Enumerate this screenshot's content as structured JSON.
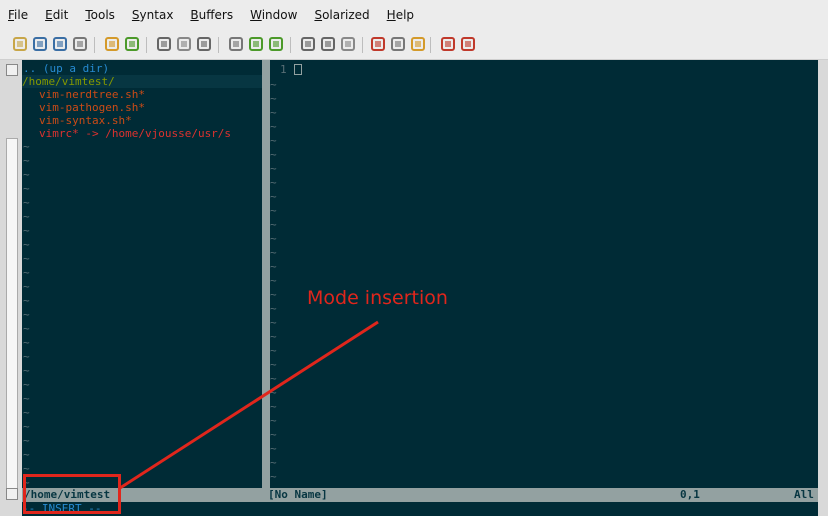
{
  "menu": [
    {
      "key": "F",
      "rest": "ile"
    },
    {
      "key": "E",
      "rest": "dit"
    },
    {
      "key": "T",
      "rest": "ools"
    },
    {
      "key": "S",
      "rest": "yntax"
    },
    {
      "key": "B",
      "rest": "uffers"
    },
    {
      "key": "W",
      "rest": "indow"
    },
    {
      "key": "S",
      "rest": "olarized"
    },
    {
      "key": "H",
      "rest": "elp"
    }
  ],
  "toolbar_icons": [
    "open-folder-icon",
    "save-icon",
    "save-all-icon",
    "print-icon",
    "undo-icon",
    "redo-icon",
    "cut-icon",
    "copy-icon",
    "paste-icon",
    "replace-icon",
    "find-next-icon",
    "find-prev-icon",
    "load-session-icon",
    "save-session-icon",
    "run-script-icon",
    "make-icon",
    "shell-icon",
    "tags-icon",
    "help-icon",
    "find-help-icon"
  ],
  "tree": {
    "up_dir": ".. (up a dir)",
    "root": "/home/vimtest/",
    "files": [
      "vim-nerdtree.sh*",
      "vim-pathogen.sh*",
      "vim-syntax.sh*",
      "vimrc* -> /home/vjousse/usr/s"
    ],
    "tilde": "~"
  },
  "buffer": {
    "line_number": "1"
  },
  "status": {
    "left_path": "/home/vimtest",
    "buffer_name": "[No Name]",
    "position": "0,1",
    "scroll": "All"
  },
  "command_line": "-- INSERT --",
  "annotation": "Mode insertion",
  "colors": {
    "bg": "#002b36",
    "blue": "#268bd2",
    "green": "#859900",
    "orange": "#cb4b16",
    "red": "#dc322f",
    "base01": "#586e75",
    "annot": "#e0261c"
  }
}
